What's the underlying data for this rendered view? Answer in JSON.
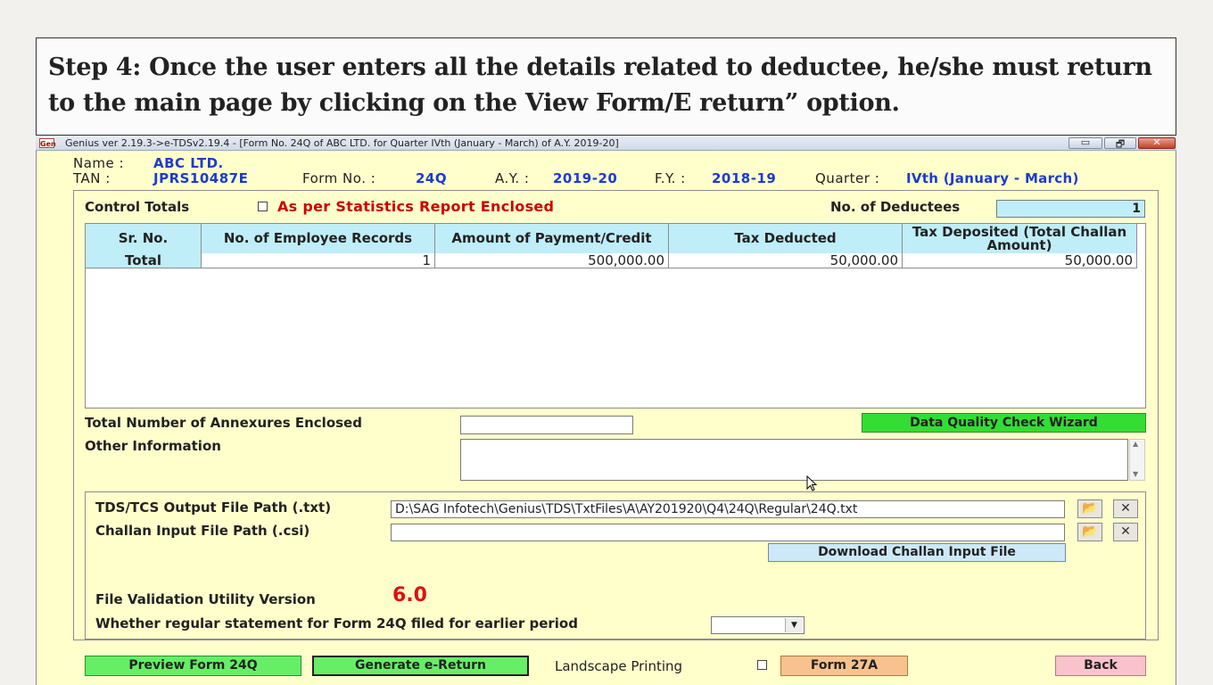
{
  "caption": "Step 4: Once the user enters all the details related to deductee, he/she must return to the main page by clicking on the View Form/E return” option.",
  "window": {
    "app_icon_text": "Gen",
    "title": "Genius ver 2.19.3->e-TDSv2.19.4 - [Form No. 24Q of ABC LTD. for Quarter IVth (January - March) of A.Y. 2019-20]",
    "min_glyph": "▭",
    "max_glyph": "🗗",
    "close_glyph": "✕"
  },
  "header": {
    "name_label": "Name :",
    "name_value": "ABC LTD.",
    "tan_label": "TAN :",
    "tan_value": "JPRS10487E",
    "form_label": "Form No. :",
    "form_value": "24Q",
    "ay_label": "A.Y. :",
    "ay_value": "2019-20",
    "fy_label": "F.Y. :",
    "fy_value": "2018-19",
    "quarter_label": "Quarter :",
    "quarter_value": "IVth (January - March)"
  },
  "control": {
    "label": "Control Totals",
    "statistics_label": "As per Statistics Report Enclosed",
    "deductees_label": "No. of Deductees",
    "deductees_value": "1"
  },
  "table": {
    "columns": [
      "Sr. No.",
      "No. of Employee Records",
      "Amount of Payment/Credit",
      "Tax Deducted",
      "Tax Deposited (Total Challan Amount)"
    ],
    "total_row": [
      "Total",
      "1",
      "500,000.00",
      "50,000.00",
      "50,000.00"
    ]
  },
  "annexures_label": "Total Number of Annexures Enclosed",
  "annexures_value": "",
  "dq_button": "Data Quality Check Wizard",
  "other_info_label": "Other Information",
  "files": {
    "output_label": "TDS/TCS Output File Path (.txt)",
    "output_value": "D:\\SAG Infotech\\Genius\\TDS\\TxtFiles\\A\\AY201920\\Q4\\24Q\\Regular\\24Q.txt",
    "challan_label": "Challan Input File Path (.csi)",
    "challan_value": "",
    "download_button": "Download Challan Input File",
    "fvu_label": "File Validation Utility Version",
    "fvu_value": "6.0",
    "regular_label": "Whether regular statement for Form 24Q filed for earlier period",
    "regular_value": ""
  },
  "footer": {
    "preview": "Preview Form 24Q",
    "generate": "Generate e-Return",
    "landscape": "Landscape Printing",
    "form27a": "Form 27A",
    "back": "Back"
  },
  "colors": {
    "window_bg": "#ffffcc",
    "table_header": "#bfeef8",
    "green": "#33dd33",
    "orange": "#f7c28d",
    "pink": "#f9c2cc",
    "red_text": "#cc0000",
    "blue_value": "#1c3ccc"
  },
  "icons": [
    "app-icon",
    "minimize-icon",
    "maximize-icon",
    "close-icon",
    "folder-open-icon",
    "clear-x-icon",
    "dropdown-arrow-icon",
    "mouse-cursor-icon"
  ]
}
